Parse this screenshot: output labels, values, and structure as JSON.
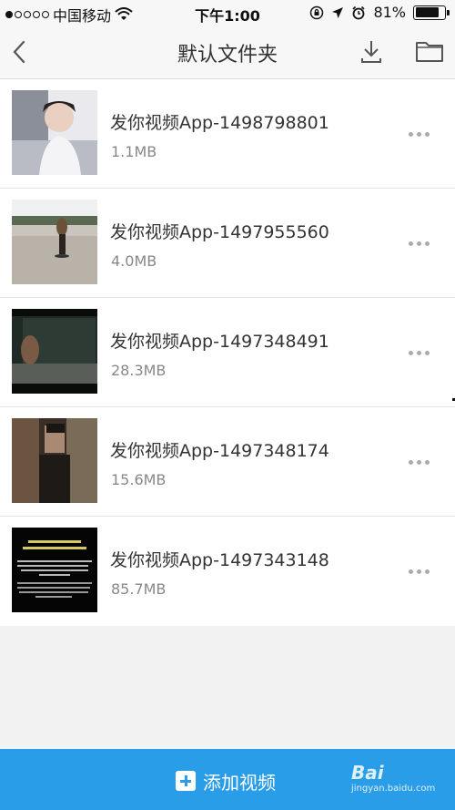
{
  "status_bar": {
    "carrier": "中国移动",
    "time": "下午1:00",
    "battery": "81%",
    "battery_level": 0.81
  },
  "nav": {
    "title": "默认文件夹"
  },
  "files": [
    {
      "name": "发你视频App-1498798801",
      "size": "1.1MB"
    },
    {
      "name": "发你视频App-1497955560",
      "size": "4.0MB"
    },
    {
      "name": "发你视频App-1497348491",
      "size": "28.3MB"
    },
    {
      "name": "发你视频App-1497348174",
      "size": "15.6MB"
    },
    {
      "name": "发你视频App-1497343148",
      "size": "85.7MB"
    }
  ],
  "bottom_bar": {
    "add_label": "添加视频"
  },
  "watermark": {
    "text": "Bai",
    "sub": "jingyan.baidu.com"
  },
  "colors": {
    "accent": "#2a9de8",
    "background": "#f2f2f2"
  }
}
